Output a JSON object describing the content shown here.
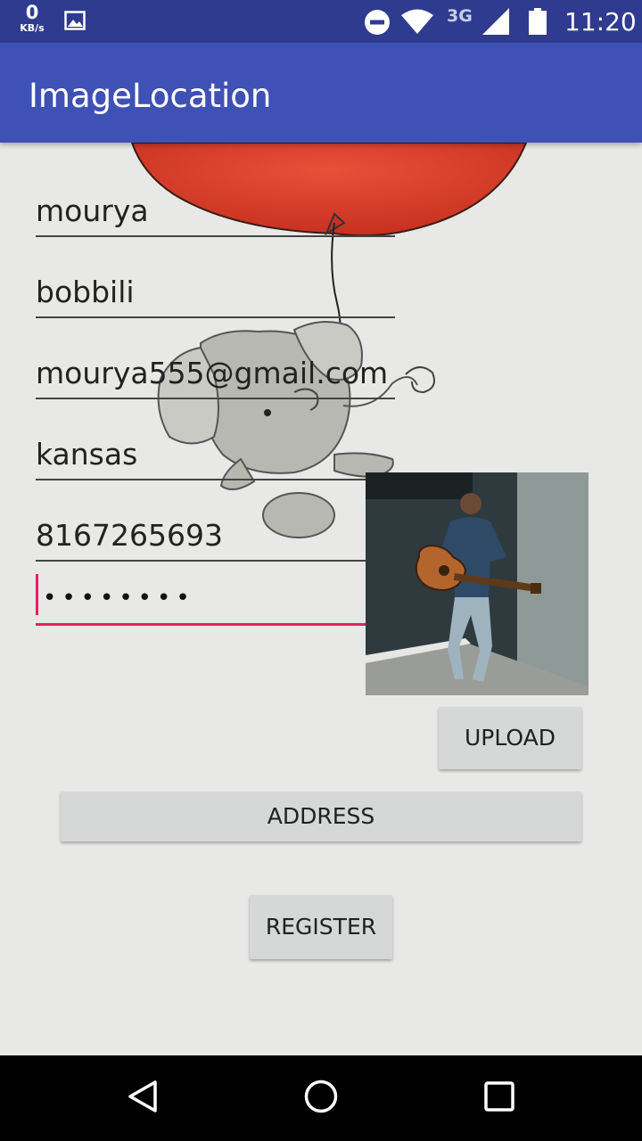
{
  "status_bar": {
    "speed_value": "0",
    "speed_unit": "KB/s",
    "network_type": "3G",
    "time": "11:20",
    "icons": [
      "gallery-icon",
      "do-not-disturb-icon",
      "wifi-icon",
      "signal-icon",
      "battery-icon"
    ]
  },
  "app_bar": {
    "title": "ImageLocation"
  },
  "form": {
    "first_name": "mourya",
    "last_name": "bobbili",
    "email": "mourya555@gmail.com",
    "city": "kansas",
    "phone": "8167265693",
    "password_mask": "••••••••"
  },
  "buttons": {
    "upload": "UPLOAD",
    "address": "ADDRESS",
    "register": "REGISTER"
  },
  "nav_bar": {
    "icons": [
      "back-icon",
      "home-icon",
      "recents-icon"
    ]
  },
  "colors": {
    "status_bar": "#2e3b8f",
    "app_bar": "#3f51b5",
    "accent": "#e91e63",
    "background": "#e8e8e6"
  }
}
